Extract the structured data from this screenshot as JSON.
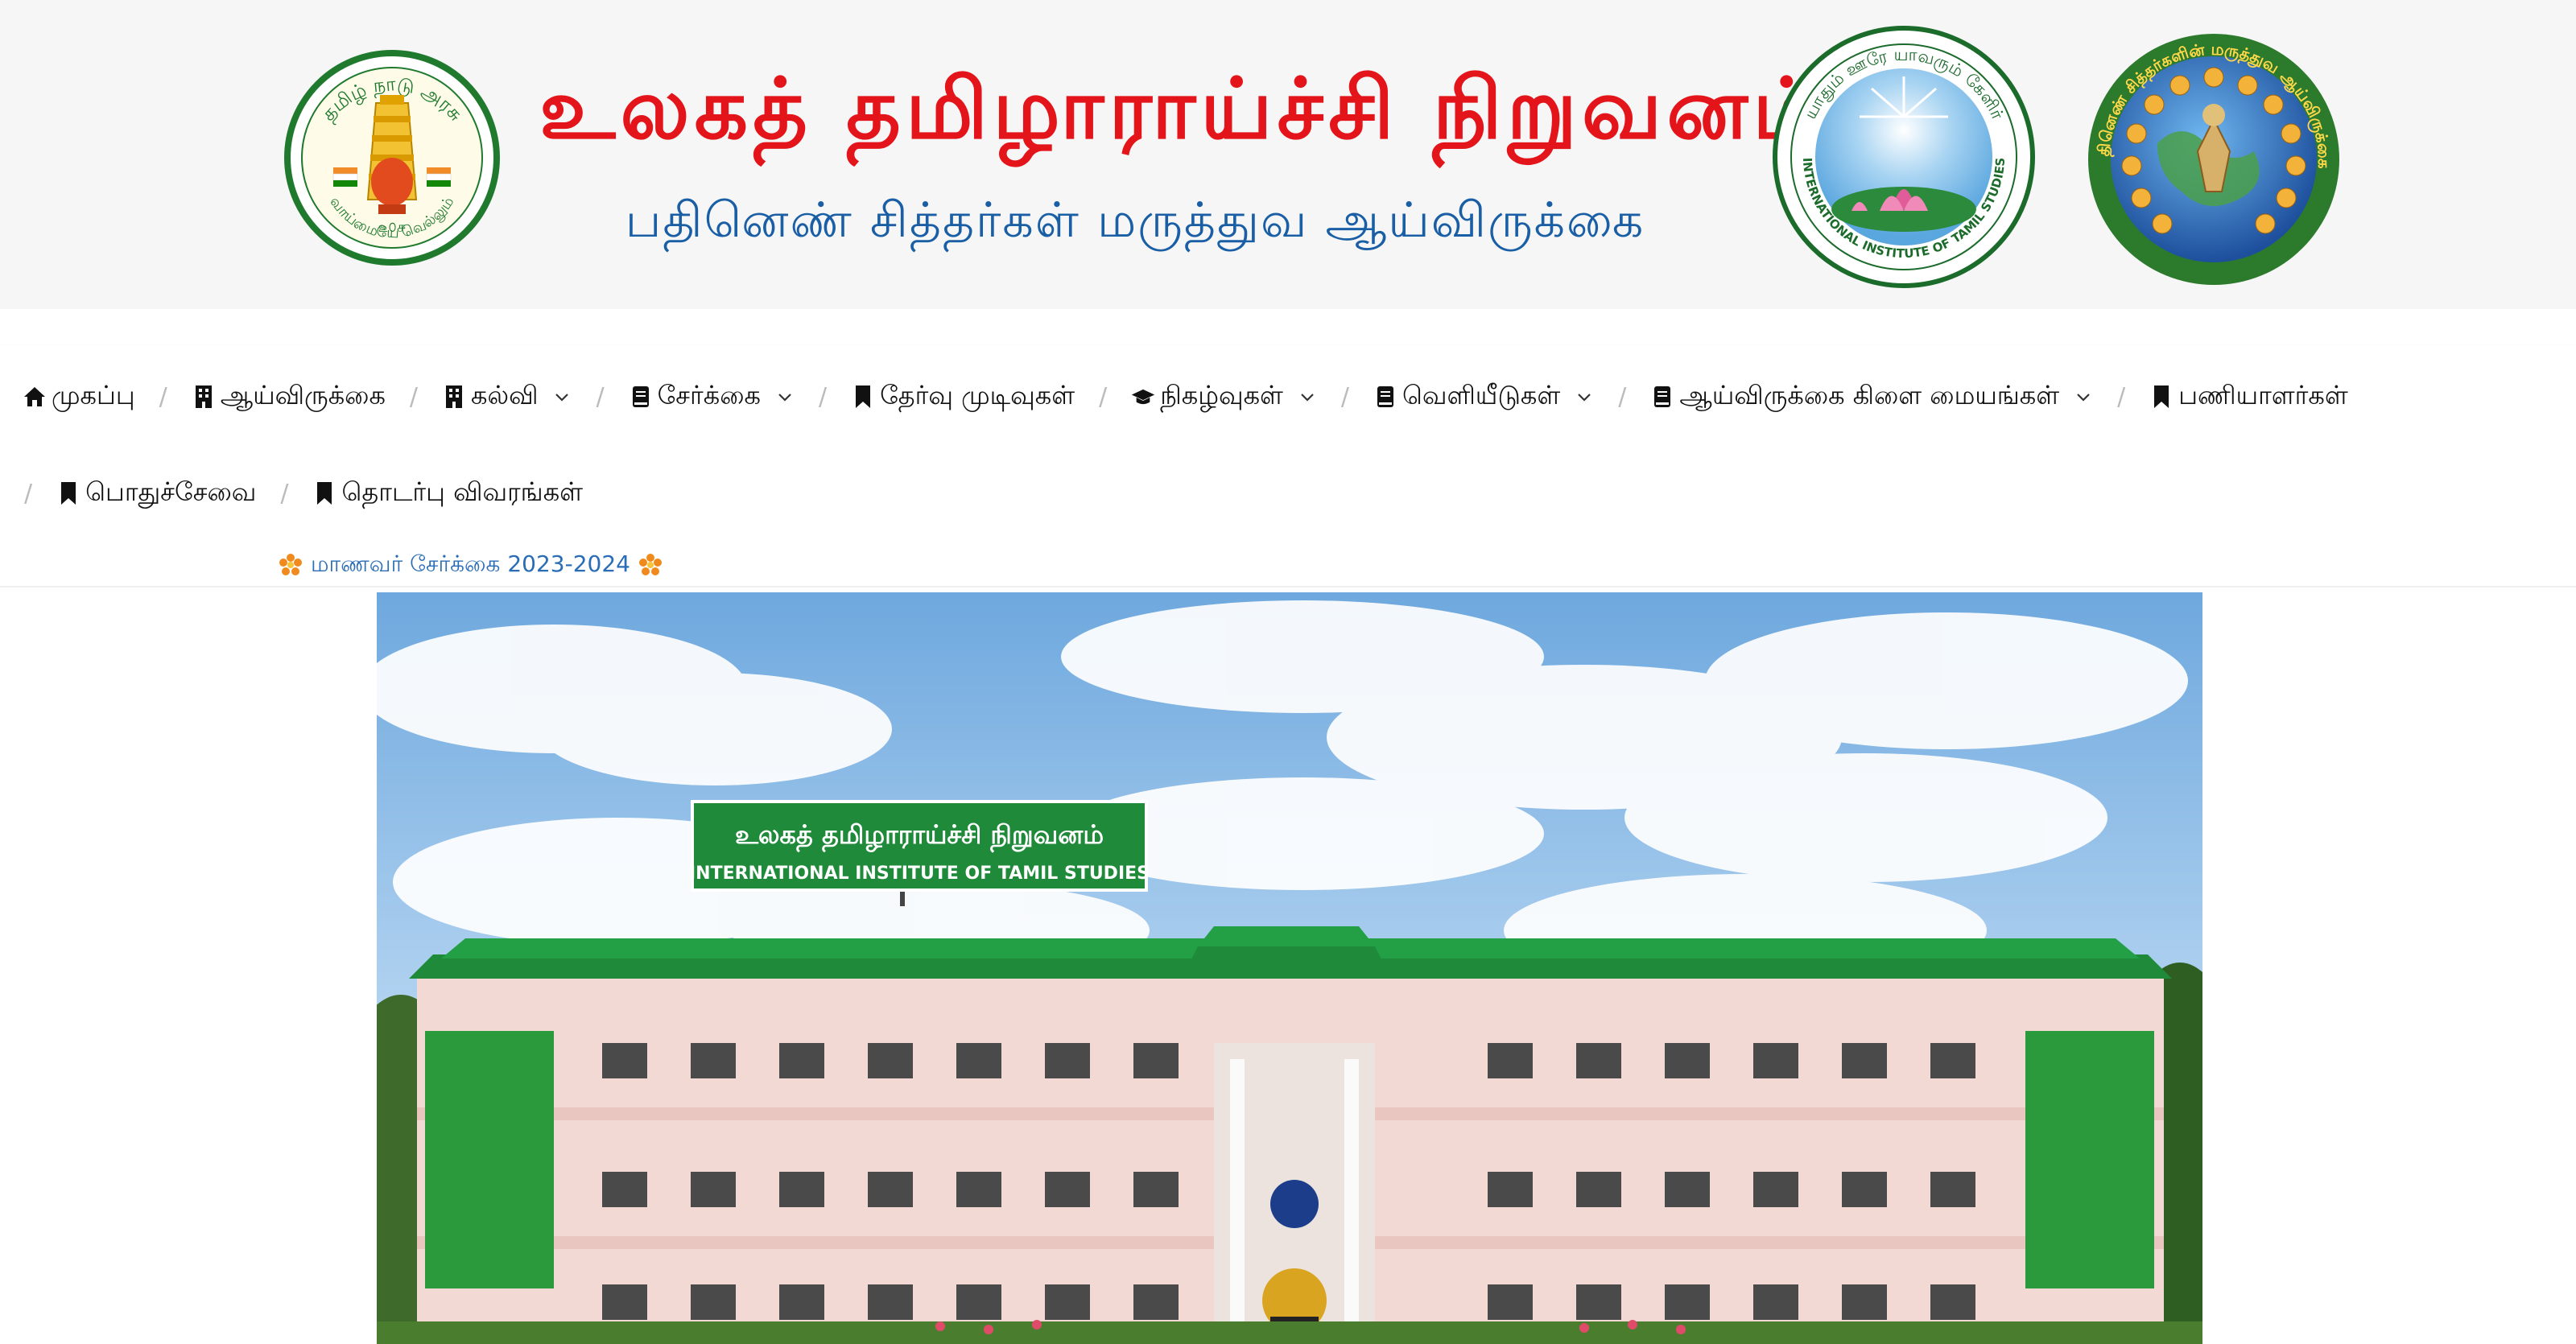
{
  "header": {
    "title": "உலகத் தமிழாராய்ச்சி நிறுவனம்",
    "subtitle": "பதினெண் சித்தர்கள் மருத்துவ ஆய்விருக்கை",
    "tn_emblem": {
      "arc_text": "தமிழ் நாடு அரசு",
      "motto": "வாய்மையே வெல்லும்"
    },
    "iits_logo": {
      "top_text": "யாதும் ஊரே யாவரும் கேளிர்",
      "bottom_text": "INTERNATIONAL INSTITUTE OF TAMIL STUDIES"
    },
    "siddha_logo": {
      "text": "பதினெண் சித்தர்களின் மருத்துவ ஆய்விருக்கை"
    }
  },
  "nav": {
    "row1": [
      {
        "label": "முகப்பு",
        "icon": "home-icon",
        "dropdown": false
      },
      {
        "label": "ஆய்விருக்கை",
        "icon": "building-icon",
        "dropdown": false
      },
      {
        "label": "கல்வி",
        "icon": "building-icon",
        "dropdown": true
      },
      {
        "label": "சேர்க்கை",
        "icon": "book-icon",
        "dropdown": true
      },
      {
        "label": "தேர்வு முடிவுகள்",
        "icon": "bookmark-icon",
        "dropdown": false
      },
      {
        "label": "நிகழ்வுகள்",
        "icon": "graduation-cap-icon",
        "dropdown": true
      },
      {
        "label": "வெளியீடுகள்",
        "icon": "book-icon",
        "dropdown": true
      },
      {
        "label": "ஆய்விருக்கை கிளை மையங்கள்",
        "icon": "book-icon",
        "dropdown": true
      },
      {
        "label": "பணியாளர்கள்",
        "icon": "bookmark-icon",
        "dropdown": false
      }
    ],
    "row2": [
      {
        "label": "பொதுச்சேவை",
        "icon": "bookmark-icon",
        "dropdown": false
      },
      {
        "label": "தொடர்பு விவரங்கள்",
        "icon": "bookmark-icon",
        "dropdown": false
      }
    ],
    "separator": "/"
  },
  "ticker": {
    "text": "மாணவர் சேர்க்கை 2023-2024"
  },
  "hero": {
    "sign_tamil": "உலகத் தமிழாராய்ச்சி நிறுவனம்",
    "sign_english": "INTERNATIONAL INSTITUTE OF TAMIL STUDIES"
  },
  "colors": {
    "title_red": "#e4141b",
    "subtitle_blue": "#1a5fa5",
    "ticker_blue": "#2a6db6",
    "roof_green": "#1e8a3a",
    "wall_pink": "#f3d9d4"
  }
}
